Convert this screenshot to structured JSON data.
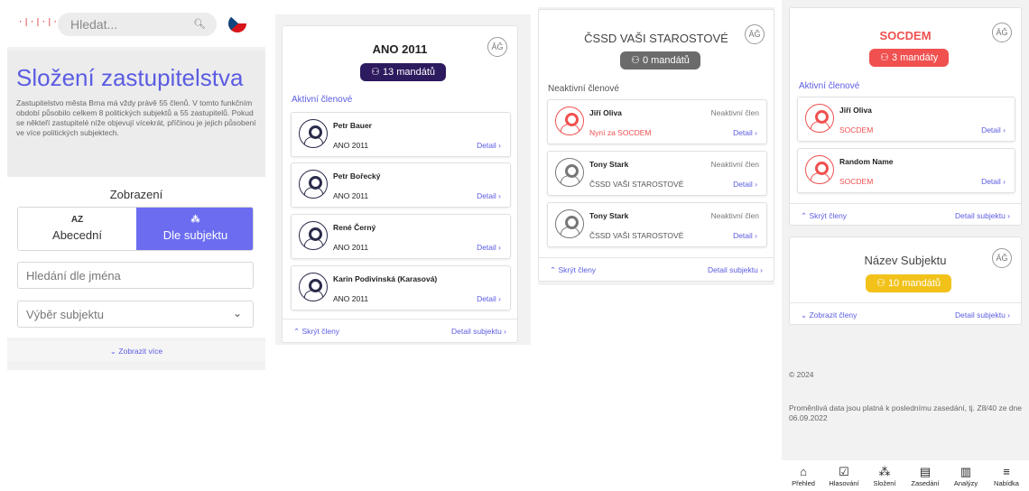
{
  "header": {
    "logo_text": "·|·|·|·|",
    "search_placeholder": "Hledat...",
    "search_icon": "search-icon",
    "flag": "czech-flag"
  },
  "intro": {
    "title": "Složení zastupitelstva",
    "text": "Zastupitelstvo města Brna má vždy právě 55 členů. V tomto funkčním období působilo celkem 8 politických subjektů a 55 zastupitelů. Pokud se někteří zastupitelé níže objevují vícekrát, příčinou je jejich působení ve více politických subjektech."
  },
  "display": {
    "title": "Zobrazení",
    "options": [
      {
        "icon": "AZ",
        "label": "Abecední"
      },
      {
        "icon": "people-icon",
        "label": "Dle subjektu"
      }
    ],
    "name_search_placeholder": "Hledání dle jména",
    "subject_select": "Výběr subjektu",
    "show_more": "⌄ Zobrazit více"
  },
  "colors": {
    "accent": "#6b6cf0",
    "ano": "#2e1a5e",
    "cssd": "#6b6b6b",
    "socdem": "#f05050",
    "yellow": "#f2c21b"
  },
  "cards": [
    {
      "name": "ANO 2011",
      "badge": "13 mandátů",
      "section": "Aktivní členové",
      "members": [
        {
          "name": "Petr Bauer",
          "party": "ANO 2011",
          "detail": "Detail ›"
        },
        {
          "name": "Petr Bořecký",
          "party": "ANO 2011",
          "detail": "Detail ›"
        },
        {
          "name": "René Černý",
          "party": "ANO 2011",
          "detail": "Detail ›"
        },
        {
          "name": "Karin Podivinská (Karasová)",
          "party": "ANO 2011",
          "detail": "Detail ›"
        }
      ],
      "foot_left": "⌃ Skrýt členy",
      "foot_right": "Detail subjektu ›"
    },
    {
      "name": "ČSSD VAŠI STAROSTOVÉ",
      "badge": "0 mandátů",
      "section": "Neaktivní členové",
      "members": [
        {
          "name": "Jiří Oliva",
          "party": "Nyní za SOCDEM",
          "status": "Neaktivní člen",
          "detail": "Detail ›"
        },
        {
          "name": "Tony Stark",
          "party": "ČSSD VAŠI STAROSTOVÉ",
          "status": "Neaktivní člen",
          "detail": "Detail ›"
        },
        {
          "name": "Tony Stark",
          "party": "ČSSD VAŠI STAROSTOVÉ",
          "status": "Neaktivní člen",
          "detail": "Detail ›"
        }
      ],
      "foot_left": "⌃ Skrýt členy",
      "foot_right": "Detail subjektu ›"
    },
    {
      "name": "SOCDEM",
      "badge": "3 mandáty",
      "section": "Aktivní členové",
      "members": [
        {
          "name": "Jiří Oliva",
          "party": "SOCDEM",
          "detail": "Detail ›"
        },
        {
          "name": "Random Name",
          "party": "SOCDEM",
          "detail": "Detail ›"
        }
      ],
      "foot_left": "⌃ Skrýt členy",
      "foot_right": "Detail subjektu ›"
    },
    {
      "name": "Název Subjektu",
      "badge": "10 mandátů",
      "foot_left": "⌄ Zobrazit členy",
      "foot_right": "Detail subjektu ›"
    }
  ],
  "scales_icon": "ĀǦ",
  "footer": {
    "copyright": "© 2024",
    "note": "Proměnlivá data jsou platná k poslednímu zasedání, tj. Z8/40 ze dne 06.09.2022"
  },
  "nav": [
    {
      "icon": "⌂",
      "label": "Přehled"
    },
    {
      "icon": "☑",
      "label": "Hlasování"
    },
    {
      "icon": "⁂",
      "label": "Složení"
    },
    {
      "icon": "▤",
      "label": "Zasedání"
    },
    {
      "icon": "▥",
      "label": "Analýzy"
    },
    {
      "icon": "≡",
      "label": "Nabídka"
    }
  ],
  "badge_icon": "⚇"
}
